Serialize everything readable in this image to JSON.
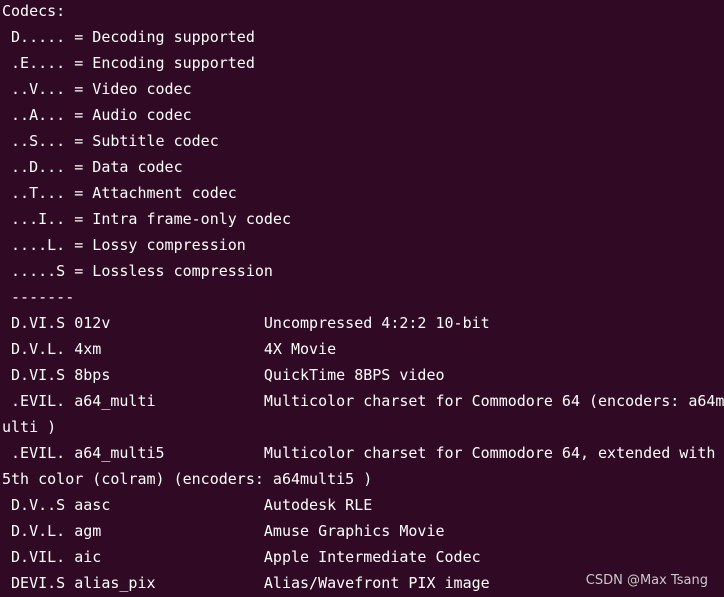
{
  "terminal": {
    "lines": [
      "Codecs:",
      " D..... = Decoding supported",
      " .E.... = Encoding supported",
      " ..V... = Video codec",
      " ..A... = Audio codec",
      " ..S... = Subtitle codec",
      " ..D... = Data codec",
      " ..T... = Attachment codec",
      " ...I.. = Intra frame-only codec",
      " ....L. = Lossy compression",
      " .....S = Lossless compression",
      " -------",
      " D.VI.S 012v                 Uncompressed 4:2:2 10-bit",
      " D.V.L. 4xm                  4X Movie",
      " D.VI.S 8bps                 QuickTime 8BPS video",
      " .EVIL. a64_multi            Multicolor charset for Commodore 64 (encoders: a64m",
      "ulti )",
      " .EVIL. a64_multi5           Multicolor charset for Commodore 64, extended with",
      "5th color (colram) (encoders: a64multi5 )",
      " D.V..S aasc                 Autodesk RLE",
      " D.V.L. agm                  Amuse Graphics Movie",
      " D.VIL. aic                  Apple Intermediate Codec",
      " DEVI.S alias_pix            Alias/Wavefront PIX image"
    ]
  },
  "watermark": "CSDN @Max Tsang"
}
